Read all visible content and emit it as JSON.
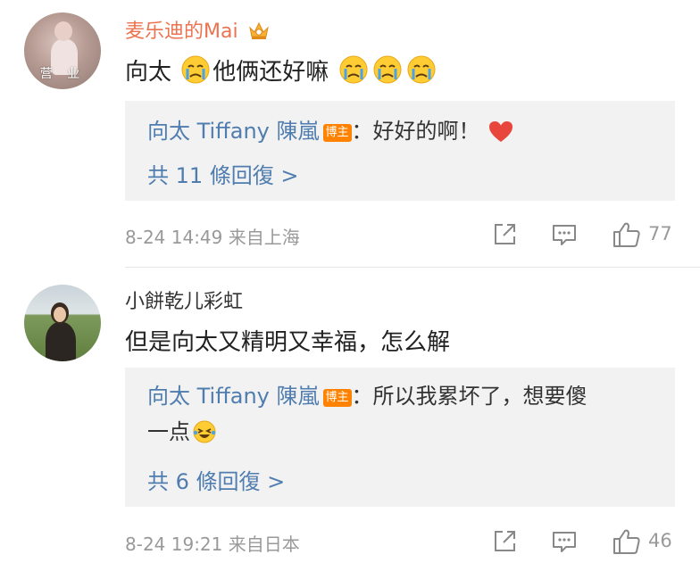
{
  "comments": [
    {
      "avatar_tag": "营 业",
      "username": "麦乐迪的Mai",
      "user_badge_icon": "crown-icon",
      "text": "向太",
      "text_after_emoji": "他俩还好嘛",
      "reply": {
        "author": "向太 Tiffany 陳嵐",
        "badge": "博主",
        "text": "：好好的啊！",
        "text_icon": "heart-icon",
        "more": "共 11 條回復 >"
      },
      "date": "8-24 14:49",
      "location": "来自上海",
      "likes": "77"
    },
    {
      "avatar_tag": "",
      "username": "小餅乾儿彩虹",
      "text": "但是向太又精明又幸福，怎么解",
      "reply": {
        "author": "向太 Tiffany 陳嵐",
        "badge": "博主",
        "text": "：所以我累坏了，想要傻",
        "text_line2": "一点",
        "text_icon": "laughing-emoji-icon",
        "more": "共 6 條回復 >"
      },
      "date": "8-24 19:21",
      "location": "来自日本",
      "likes": "46"
    }
  ],
  "colors": {
    "username_highlight": "#eb7350",
    "link_blue": "#507daf",
    "badge_orange": "#ff8200",
    "meta_gray": "#999999",
    "reply_bg": "#f2f2f2"
  }
}
